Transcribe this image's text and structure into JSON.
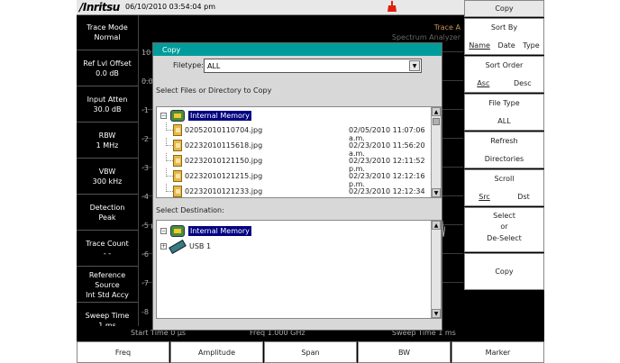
{
  "header": {
    "logo": "/Inritsu",
    "datetime": "06/10/2010 03:54:04 pm"
  },
  "left_panel": [
    {
      "title": "Trace Mode",
      "value": "Normal"
    },
    {
      "title": "Ref Lvl Offset",
      "value": "0.0 dB"
    },
    {
      "title": "Input Atten",
      "value": "30.0 dB"
    },
    {
      "title": "RBW",
      "value": "1 MHz"
    },
    {
      "title": "VBW",
      "value": "300 kHz"
    },
    {
      "title": "Detection",
      "value": "Peak"
    },
    {
      "title": "Trace Count",
      "value": "- -"
    },
    {
      "title": "Reference Source",
      "value": "Int Std Accy"
    },
    {
      "title": "Sweep Time",
      "value": "1 ms"
    }
  ],
  "graph": {
    "trace_label": "Trace A",
    "mode_label": "Spectrum Analyzer",
    "y_labels": [
      "10",
      "0.0",
      "-1",
      "-2",
      "-3",
      "-4",
      "-5",
      "-6",
      "-7",
      "-8"
    ],
    "start_time": "Start Time  0 µs",
    "freq": "Freq 1.000 GHz",
    "sweep_time": "Sweep Time   1 ms"
  },
  "dialog": {
    "title": "Copy",
    "filetype_label": "Filetype:",
    "filetype_value": "ALL",
    "source_label": "Select Files or Directory to Copy",
    "source_root": "Internal Memory",
    "files": [
      {
        "name": "02052010110704.jpg",
        "date": "02/05/2010 11:07:06 a.m."
      },
      {
        "name": "02232010115618.jpg",
        "date": "02/23/2010 11:56:20 a.m."
      },
      {
        "name": "02232010121150.jpg",
        "date": "02/23/2010 12:11:52 p.m."
      },
      {
        "name": "02232010121215.jpg",
        "date": "02/23/2010 12:12:16 p.m."
      },
      {
        "name": "02232010121233.jpg",
        "date": "02/23/2010 12:12:34 p.m."
      }
    ],
    "destination_label": "Select Destination:",
    "dest_root": "Internal Memory",
    "dest_usb": "USB 1"
  },
  "right_keys": {
    "title": "Copy",
    "sort_by": {
      "title": "Sort By",
      "options": [
        "Name",
        "Date",
        "Type"
      ],
      "selected": "Name"
    },
    "sort_order": {
      "title": "Sort Order",
      "options": [
        "Asc",
        "Desc"
      ],
      "selected": "Asc"
    },
    "file_type": {
      "title": "File Type",
      "value": "ALL"
    },
    "refresh": {
      "line1": "Refresh",
      "line2": "Directories"
    },
    "scroll": {
      "title": "Scroll",
      "options": [
        "Src",
        "Dst"
      ],
      "selected": "Src"
    },
    "select": {
      "line1": "Select",
      "line2": "or",
      "line3": "De-Select"
    },
    "copy": "Copy"
  },
  "bottom_menu": [
    "Freq",
    "Amplitude",
    "Span",
    "BW",
    "Marker"
  ],
  "colors": {
    "dialog_title_bg": "#009c9c",
    "selection_bg": "#000080",
    "trace_label": "#c89650",
    "alert": "#e02010"
  }
}
